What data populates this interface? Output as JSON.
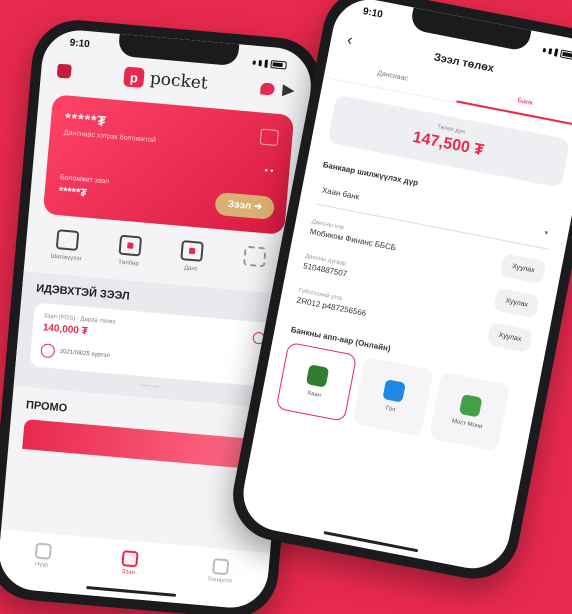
{
  "left_phone": {
    "status_time": "9:10",
    "logo_text": "pocket",
    "card": {
      "balance": "*****₮",
      "subtitle": "Данснаас хэтрэх боломжтой",
      "dots": "•  •",
      "loan_label": "Боломжит зээл",
      "loan_value": "*****₮",
      "loan_button": "Зээл ➜"
    },
    "quick_actions": [
      {
        "label": "Шилжүүлэг"
      },
      {
        "label": "Төлбөр"
      },
      {
        "label": "Данс"
      },
      {
        "label": ""
      }
    ],
    "active_loans_title": "ИДЭВХТЭЙ ЗЭЭЛ",
    "loan_item": {
      "line1": "Зээл (POS) - Дараа төлөх",
      "amount": "140,000 ₮",
      "due_text": "2021/08/25 хүртэл"
    },
    "pager": "— —",
    "section2_title": "ПРОМО",
    "tabs": [
      {
        "label": "Нүүр"
      },
      {
        "label": "Зээл"
      },
      {
        "label": "Тохиргоо"
      }
    ]
  },
  "right_phone": {
    "status_time": "9:10",
    "title": "Зээл төлөх",
    "tabs": [
      {
        "label": "Данснаас"
      },
      {
        "label": "Банк"
      }
    ],
    "amount_label": "Төлөх дүн",
    "amount_value": "147,500 ₮",
    "transfer_label": "Банкаар шилжүүлэх дүр",
    "bank_select_value": "Хаан банк",
    "bank_select_chevron": "▾",
    "copy_rows": [
      {
        "label": "Дансны нэр",
        "value": "Мобиком Финанс ББСБ",
        "button": "Хуулах"
      },
      {
        "label": "Дансны дугаар",
        "value": "5104887507",
        "button": "Хуулах"
      },
      {
        "label": "Гүйлгээний утга",
        "value": "ZR012 p487256566",
        "button": "Хуулах"
      }
    ],
    "bank_app_label": "Банкны апп-аар (Онлайн)",
    "bank_apps": [
      {
        "name": "Хаан",
        "color": "#2e7d32",
        "selected": true
      },
      {
        "name": "Гол",
        "color": "#1e88e5",
        "selected": false
      },
      {
        "name": "Мост Мони",
        "color": "#43a047",
        "selected": false
      }
    ]
  },
  "colors": {
    "background": "#e8294e",
    "accent": "#e8294e",
    "loan_button": "#d9b070"
  }
}
